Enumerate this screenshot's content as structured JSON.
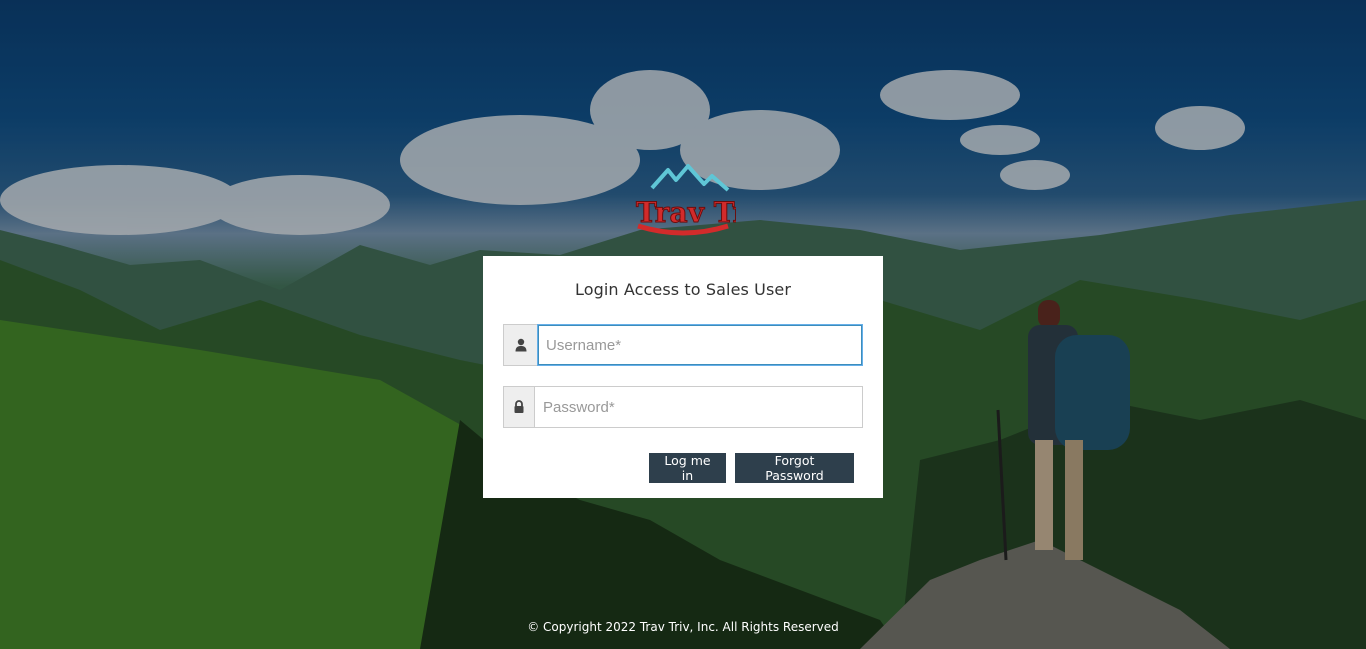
{
  "brand": {
    "logo_text": "Trav Triv",
    "logo_colors": {
      "text": "#d22b2b",
      "mountain": "#5fc6d6"
    }
  },
  "login": {
    "title": "Login Access to Sales User",
    "username": {
      "placeholder": "Username*",
      "value": "",
      "icon": "user-icon"
    },
    "password": {
      "placeholder": "Password*",
      "value": "",
      "icon": "lock-icon"
    },
    "login_label": "Log me in",
    "forgot_label": "Forgot Password"
  },
  "footer": {
    "copyright": "© Copyright 2022 Trav Triv, Inc. All Rights Reserved"
  },
  "colors": {
    "button_bg": "#2e3f4c",
    "card_bg": "#ffffff",
    "focus_border": "#3c8dbc"
  }
}
